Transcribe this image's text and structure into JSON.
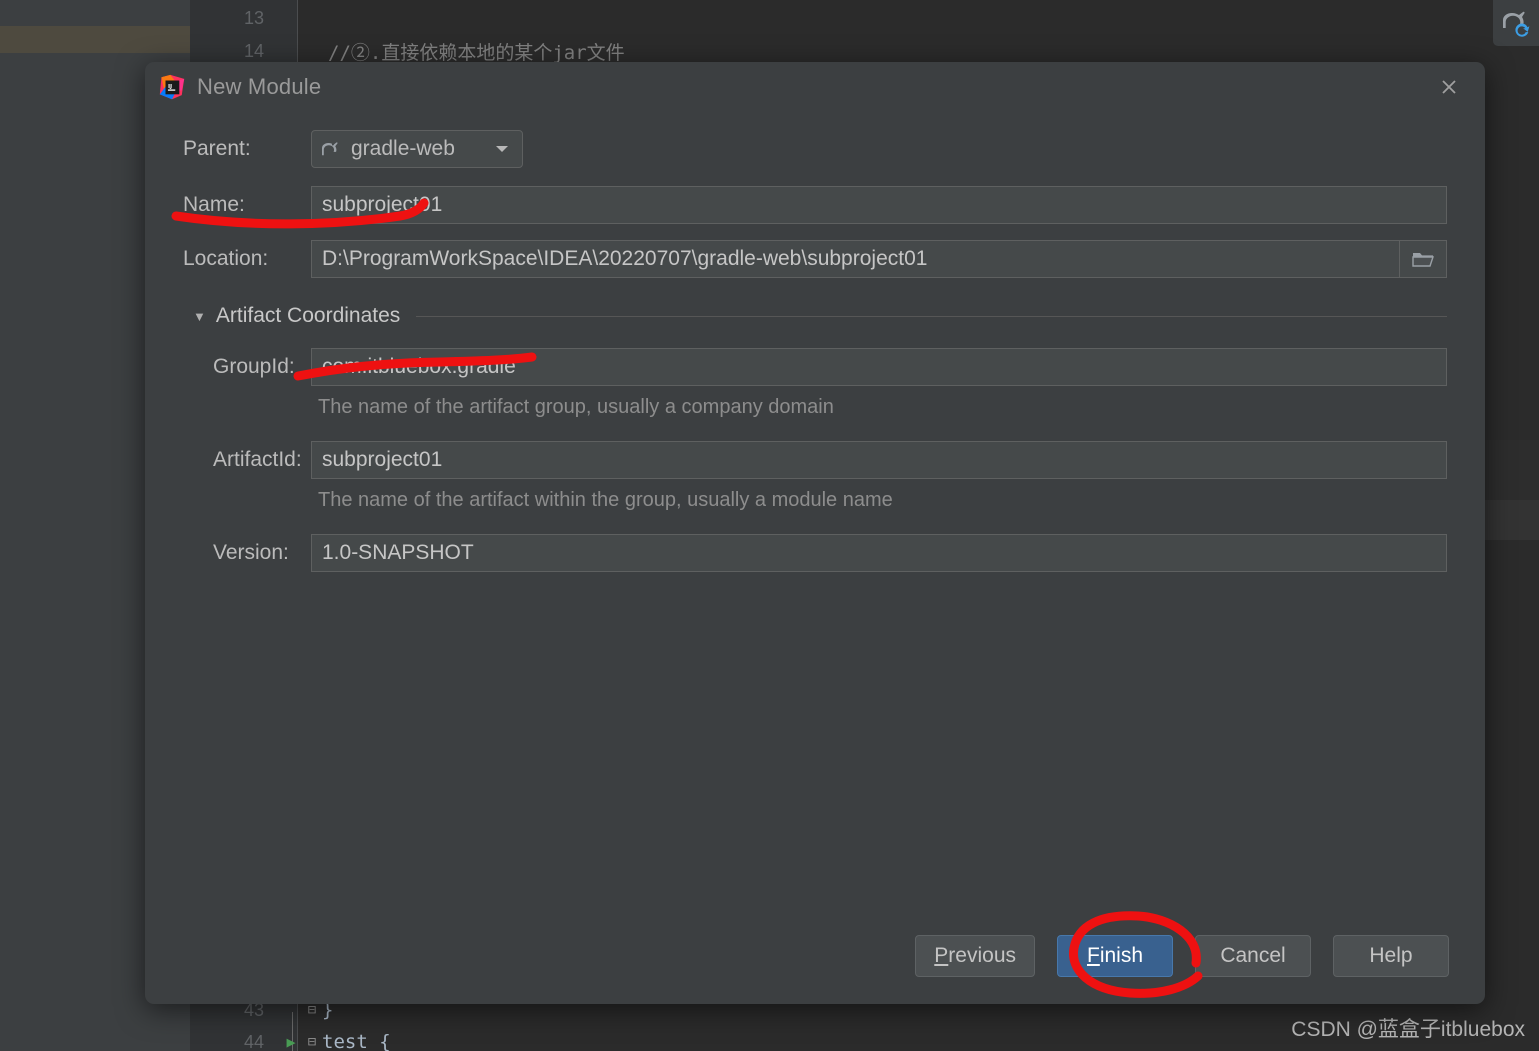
{
  "background": {
    "watermark": "CSDN @蓝盒子itbluebox",
    "gradle_sync_icon": "gradle-refresh-icon",
    "code_lines": [
      {
        "number": "13",
        "text": "",
        "type": "blank"
      },
      {
        "number": "14",
        "text": "//②.直接依赖本地的某个jar文件",
        "type": "comment"
      },
      {
        "number": "43",
        "text": "}",
        "type": "code"
      },
      {
        "number": "44",
        "text": "test {",
        "type": "code"
      }
    ]
  },
  "dialog": {
    "icon": "intellij-idea-icon",
    "title": "New Module",
    "close_icon": "close-icon",
    "parent": {
      "label": "Parent:",
      "icon": "gradle-elephant-icon",
      "value": "gradle-web",
      "chevron_icon": "chevron-down-icon"
    },
    "name": {
      "label": "Name:",
      "value": "subproject01"
    },
    "location": {
      "label": "Location:",
      "value": "D:\\ProgramWorkSpace\\IDEA\\20220707\\gradle-web\\subproject01",
      "browse_icon": "folder-icon"
    },
    "artifact_section": {
      "title": "Artifact Coordinates",
      "expanded": true,
      "triangle_icon": "triangle-down-icon",
      "group_id": {
        "label": "GroupId:",
        "value": "com.itbluebox.gradle",
        "hint": "The name of the artifact group, usually a company domain"
      },
      "artifact_id": {
        "label": "ArtifactId:",
        "value": "subproject01",
        "hint": "The name of the artifact within the group, usually a module name"
      },
      "version": {
        "label": "Version:",
        "value": "1.0-SNAPSHOT"
      }
    },
    "buttons": {
      "previous": {
        "label": "Previous",
        "mnemonic": "P"
      },
      "finish": {
        "label": "Finish",
        "mnemonic": "F",
        "primary": true
      },
      "cancel": {
        "label": "Cancel"
      },
      "help": {
        "label": "Help"
      }
    }
  },
  "annotations": {
    "color": "#ee1111",
    "items": [
      {
        "name": "underline-name-field",
        "shape": "stroke"
      },
      {
        "name": "underline-groupid-field",
        "shape": "stroke"
      },
      {
        "name": "circle-finish-button",
        "shape": "ellipse"
      }
    ]
  }
}
